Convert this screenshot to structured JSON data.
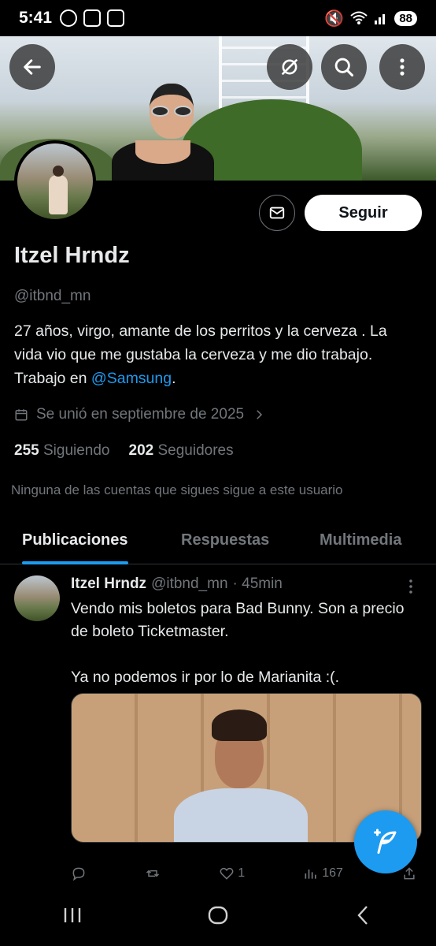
{
  "status_bar": {
    "time": "5:41",
    "battery": "88"
  },
  "banner": {
    "back_icon": "arrow-left-icon",
    "icons": [
      "grok-icon",
      "search-icon",
      "more-vertical-icon"
    ]
  },
  "profile": {
    "follow_label": "Seguir",
    "display_name": "Itzel Hrndz",
    "handle": "@itbnd_mn",
    "bio_text": "27 años, virgo, amante de los perritos y la cerveza . La vida vio que me gustaba la cerveza y me dio trabajo. Trabajo en ",
    "bio_mention": "@Samsung",
    "bio_end": ".",
    "joined": "Se unió en septiembre de 2025",
    "following_count": "255",
    "following_label": "Siguiendo",
    "followers_count": "202",
    "followers_label": "Seguidores",
    "mutual_note": "Ninguna de las cuentas que sigues sigue a este usuario"
  },
  "tabs": [
    {
      "label": "Publicaciones"
    },
    {
      "label": "Respuestas"
    },
    {
      "label": "Multimedia"
    }
  ],
  "tweet": {
    "name": "Itzel Hrndz",
    "handle": "@itbnd_mn",
    "time": "· 45min",
    "text": "Vendo mis boletos para Bad Bunny. Son a precio de boleto Ticketmaster.\n\nYa no podemos ir por lo de Marianita :(.",
    "likes": "1",
    "views": "167"
  },
  "colors": {
    "accent": "#1d9bf0",
    "muted": "#71767b",
    "text": "#e7e9ea"
  }
}
